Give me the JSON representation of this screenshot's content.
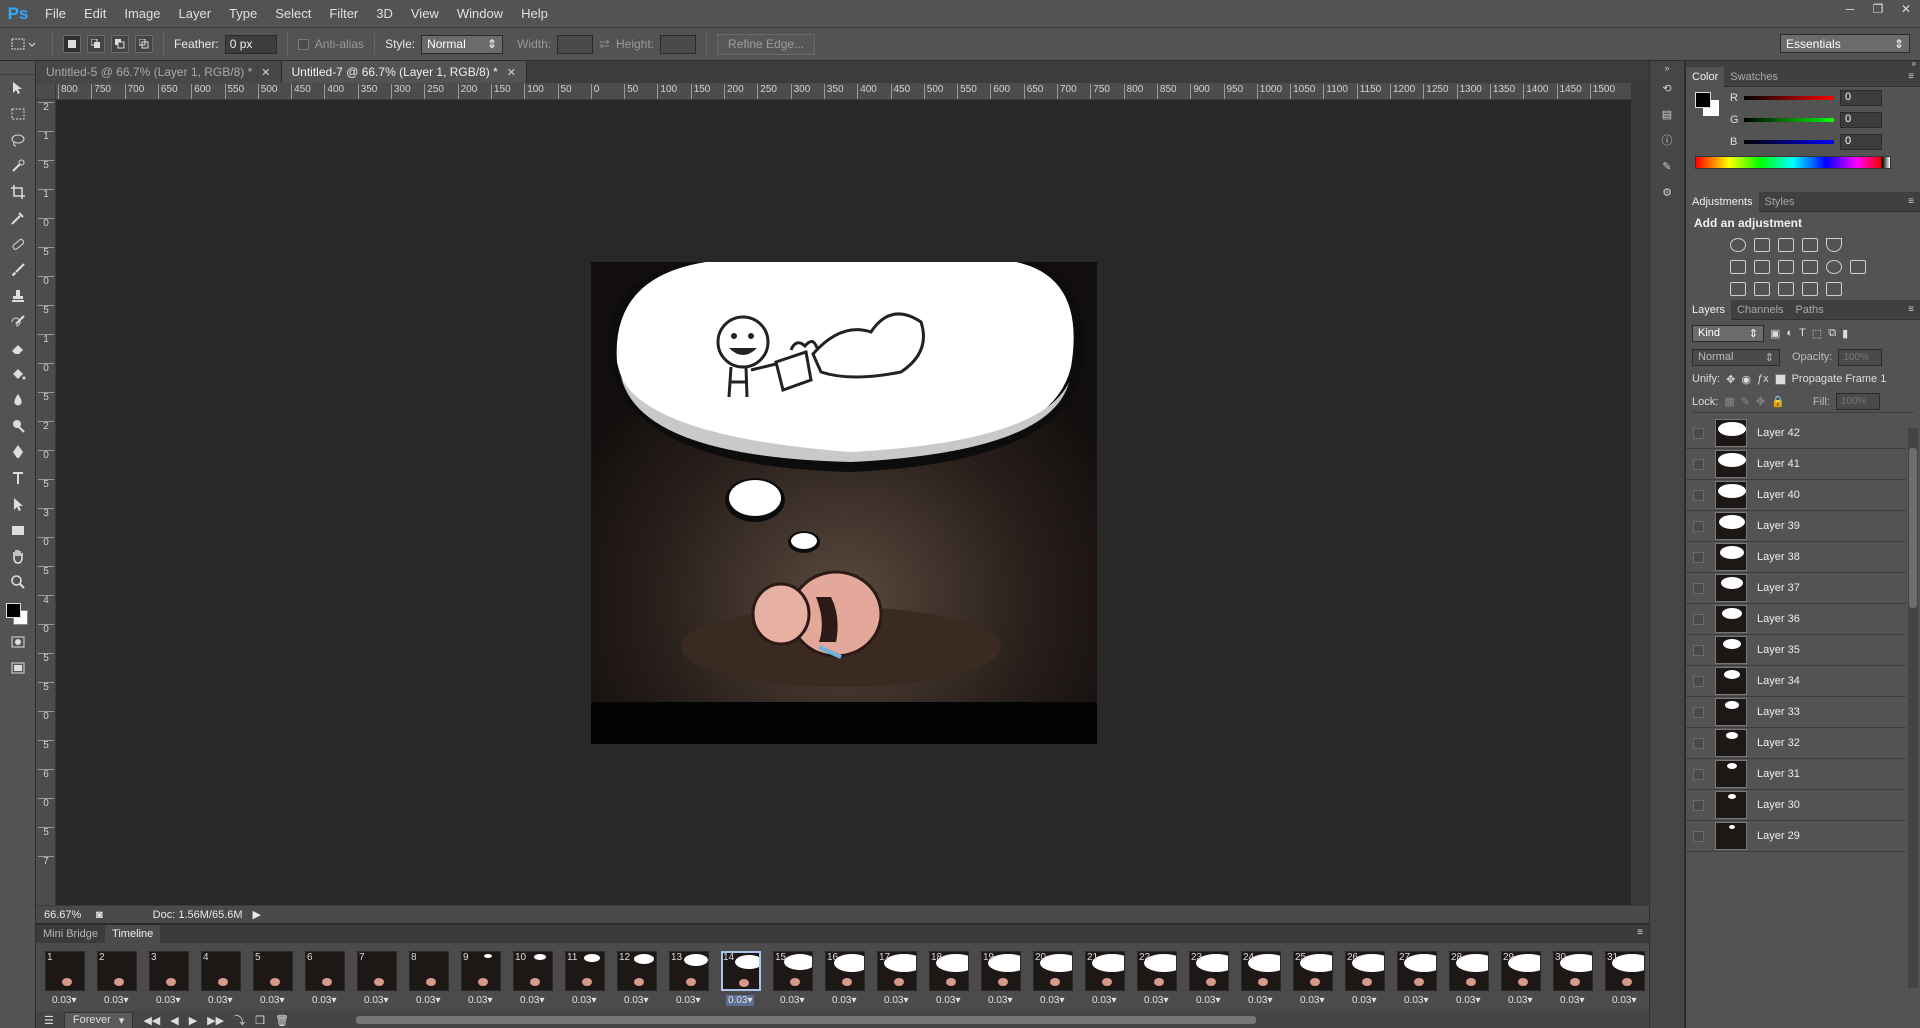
{
  "app": {
    "logo": "Ps"
  },
  "menu": [
    "File",
    "Edit",
    "Image",
    "Layer",
    "Type",
    "Select",
    "Filter",
    "3D",
    "View",
    "Window",
    "Help"
  ],
  "window_controls": [
    "─",
    "❐",
    "✕"
  ],
  "options": {
    "feather_label": "Feather:",
    "feather_value": "0 px",
    "antialias_label": "Anti-alias",
    "style_label": "Style:",
    "style_value": "Normal",
    "width_label": "Width:",
    "height_label": "Height:",
    "refine_edge": "Refine Edge...",
    "workspace": "Essentials"
  },
  "tabs": [
    {
      "label": "Untitled-5 @ 66.7% (Layer 1, RGB/8) *",
      "active": false
    },
    {
      "label": "Untitled-7 @ 66.7% (Layer 1, RGB/8) *",
      "active": true
    }
  ],
  "hruler_ticks": [
    "800",
    "750",
    "700",
    "650",
    "600",
    "550",
    "500",
    "450",
    "400",
    "350",
    "300",
    "250",
    "200",
    "150",
    "100",
    "50",
    "0",
    "50",
    "100",
    "150",
    "200",
    "250",
    "300",
    "350",
    "400",
    "450",
    "500",
    "550",
    "600",
    "650",
    "700",
    "750",
    "800",
    "850",
    "900",
    "950",
    "1000",
    "1050",
    "1100",
    "1150",
    "1200",
    "1250",
    "1300",
    "1350",
    "1400",
    "1450",
    "1500"
  ],
  "vruler_ticks": [
    "2",
    "1",
    "5",
    "1",
    "0",
    "5",
    "0",
    "5",
    "1",
    "0",
    "5",
    "2",
    "0",
    "5",
    "3",
    "0",
    "5",
    "4",
    "0",
    "5",
    "5",
    "0",
    "5",
    "6",
    "0",
    "5",
    "7"
  ],
  "status": {
    "zoom": "66.67%",
    "doc": "Doc: 1.56M/65.6M"
  },
  "timeline": {
    "tabs": [
      "Mini Bridge",
      "Timeline"
    ],
    "active_tab": "Timeline",
    "frames": [
      {
        "n": "1",
        "delay": "0.03▾"
      },
      {
        "n": "2",
        "delay": "0.03▾"
      },
      {
        "n": "3",
        "delay": "0.03▾"
      },
      {
        "n": "4",
        "delay": "0.03▾"
      },
      {
        "n": "5",
        "delay": "0.03▾"
      },
      {
        "n": "6",
        "delay": "0.03▾"
      },
      {
        "n": "7",
        "delay": "0.03▾"
      },
      {
        "n": "8",
        "delay": "0.03▾"
      },
      {
        "n": "9",
        "delay": "0.03▾"
      },
      {
        "n": "10",
        "delay": "0.03▾"
      },
      {
        "n": "11",
        "delay": "0.03▾"
      },
      {
        "n": "12",
        "delay": "0.03▾"
      },
      {
        "n": "13",
        "delay": "0.03▾"
      },
      {
        "n": "14",
        "delay": "0.03▾"
      },
      {
        "n": "15",
        "delay": "0.03▾"
      },
      {
        "n": "16",
        "delay": "0.03▾"
      },
      {
        "n": "17",
        "delay": "0.03▾"
      },
      {
        "n": "18",
        "delay": "0.03▾"
      },
      {
        "n": "19",
        "delay": "0.03▾"
      },
      {
        "n": "20",
        "delay": "0.03▾"
      },
      {
        "n": "21",
        "delay": "0.03▾"
      },
      {
        "n": "22",
        "delay": "0.03▾"
      },
      {
        "n": "23",
        "delay": "0.03▾"
      },
      {
        "n": "24",
        "delay": "0.03▾"
      },
      {
        "n": "25",
        "delay": "0.03▾"
      },
      {
        "n": "26",
        "delay": "0.03▾"
      },
      {
        "n": "27",
        "delay": "0.03▾"
      },
      {
        "n": "28",
        "delay": "0.03▾"
      },
      {
        "n": "29",
        "delay": "0.03▾"
      },
      {
        "n": "30",
        "delay": "0.03▾"
      },
      {
        "n": "31",
        "delay": "0.03▾"
      }
    ],
    "selected_frame": "14",
    "loop": "Forever"
  },
  "color": {
    "tabs": [
      "Color",
      "Swatches"
    ],
    "r_label": "R",
    "g_label": "G",
    "b_label": "B",
    "r": "0",
    "g": "0",
    "b": "0"
  },
  "adjustments": {
    "tabs": [
      "Adjustments",
      "Styles"
    ],
    "title": "Add an adjustment"
  },
  "layers": {
    "tabs": [
      "Layers",
      "Channels",
      "Paths"
    ],
    "kind": "Kind",
    "blend": "Normal",
    "opacity_label": "Opacity:",
    "opacity": "100%",
    "unify_label": "Unify:",
    "propagate": "Propagate Frame 1",
    "lock_label": "Lock:",
    "fill_label": "Fill:",
    "fill": "100%",
    "items": [
      "Layer 42",
      "Layer 41",
      "Layer 40",
      "Layer 39",
      "Layer 38",
      "Layer 37",
      "Layer 36",
      "Layer 35",
      "Layer 34",
      "Layer 33",
      "Layer 32",
      "Layer 31",
      "Layer 30",
      "Layer 29"
    ]
  },
  "colors": {
    "accent": "#31a8ff",
    "panel": "#535353",
    "canvas_bg": "#282828"
  }
}
